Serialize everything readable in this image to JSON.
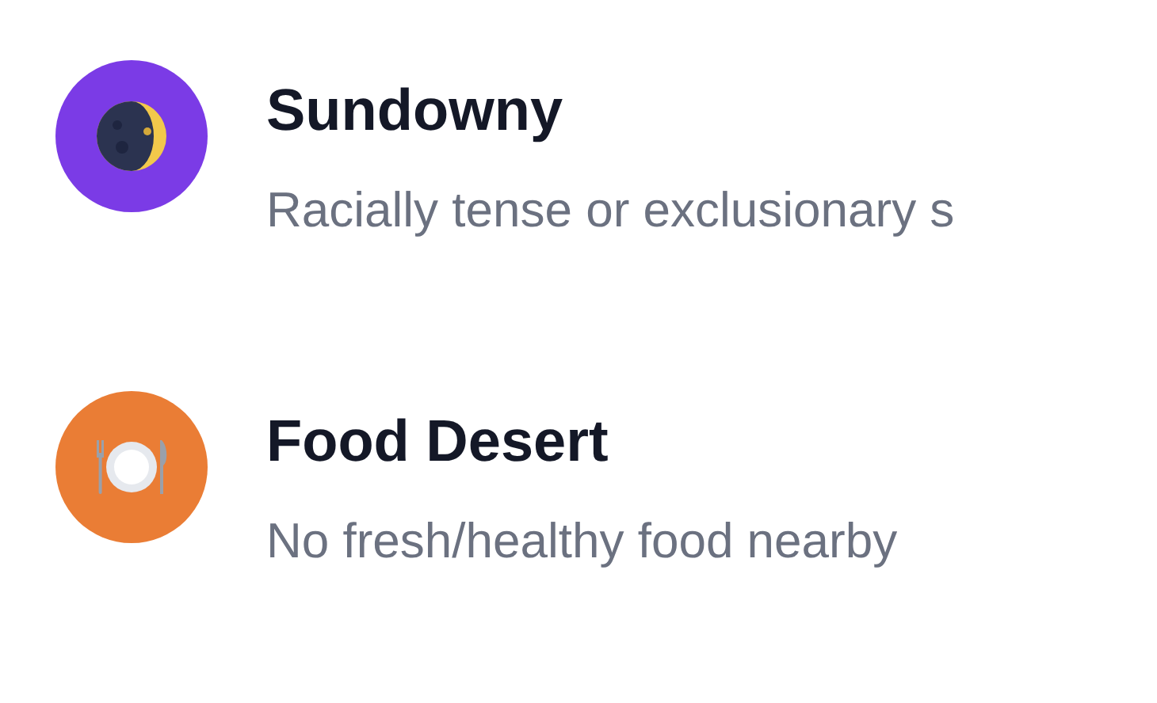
{
  "items": [
    {
      "kind": "moon",
      "color": "#7b3be6",
      "title": "Sundowny",
      "description": "Racially tense or exclusionary s"
    },
    {
      "kind": "plate",
      "color": "#ea7d35",
      "title": "Food Desert",
      "description": "No fresh/healthy food nearby"
    }
  ]
}
